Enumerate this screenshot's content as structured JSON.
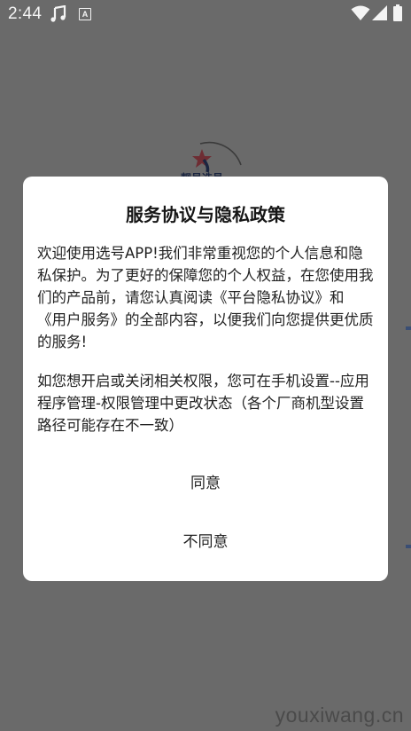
{
  "status_bar": {
    "time": "2:44",
    "icons": [
      "music-note-icon",
      "text-a-icon",
      "wifi-icon",
      "signal-icon",
      "battery-icon"
    ]
  },
  "background": {
    "logo_text": "靓号选号"
  },
  "dialog": {
    "title": "服务协议与隐私政策",
    "paragraph_1": "欢迎使用选号APP!我们非常重视您的个人信息和隐私保护。为了更好的保障您的个人权益，在您使用我们的产品前，请您认真阅读《平台隐私协议》和 《用户服务》的全部内容，以便我们向您提供更优质的服务!",
    "paragraph_2": "如您想开启或关闭相关权限，您可在手机设置--应用程序管理-权限管理中更改状态（各个厂商机型设置路径可能存在不一致）",
    "agree_label": "同意",
    "disagree_label": "不同意"
  },
  "watermark": "youxiwang.cn",
  "colors": {
    "overlay": "#6a6a6a",
    "dialog_bg": "#ffffff",
    "text": "#222222",
    "logo_red": "#c3383f",
    "logo_navy": "#1f3568"
  }
}
